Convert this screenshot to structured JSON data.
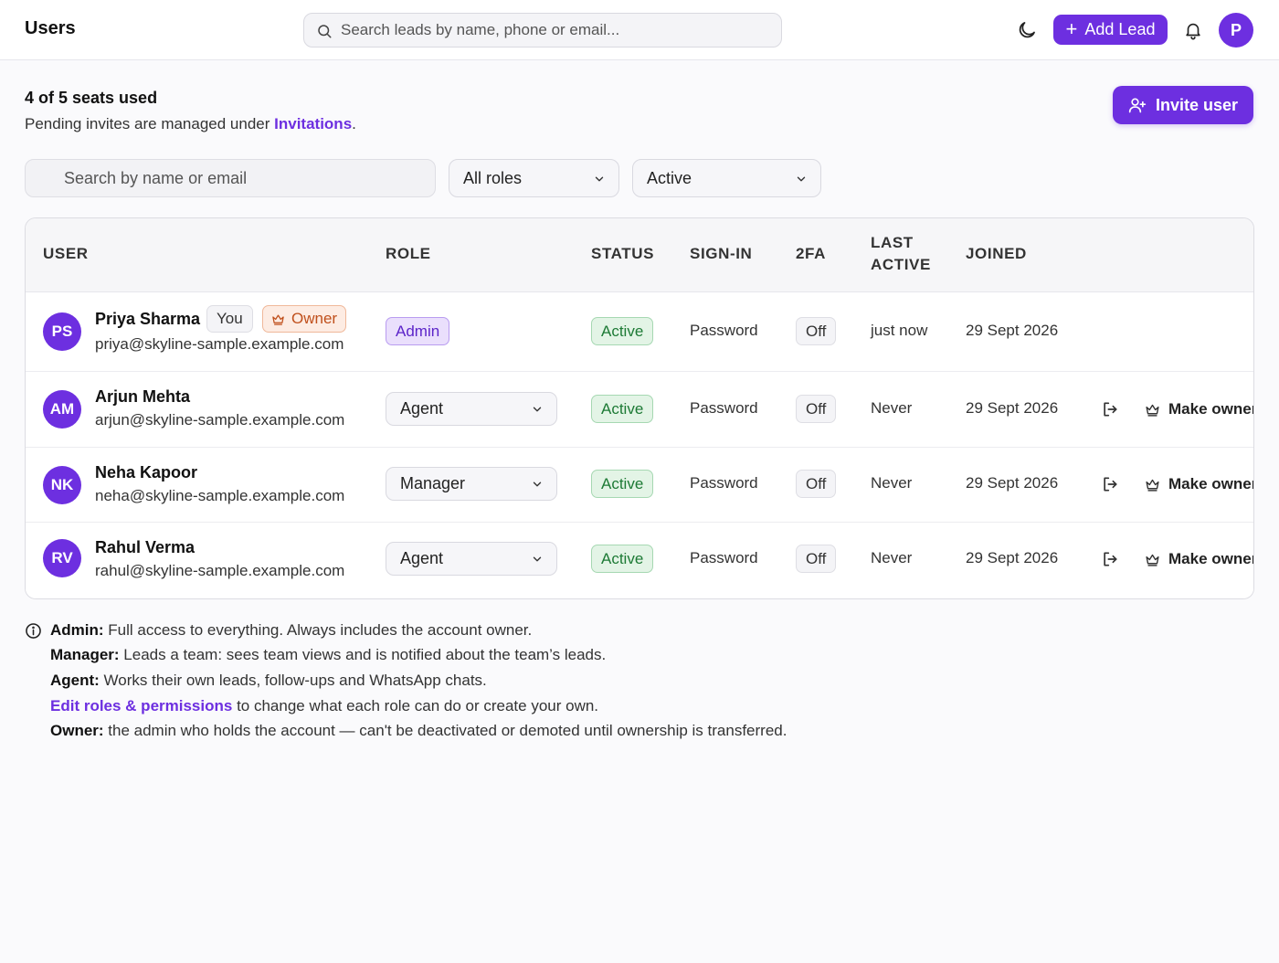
{
  "app": {
    "title": "Users"
  },
  "topbar": {
    "search_placeholder": "Search leads by name, phone or email...",
    "add_lead_label": "Add Lead",
    "add_lead_icon": "plus-icon",
    "profile_initial": "P",
    "theme_icon": "moon-icon",
    "notifications_icon": "bell-icon"
  },
  "seats": {
    "title": "4 of 5 seats used",
    "subtitle_prefix": "Pending invites are managed under ",
    "invitations_link": "Invitations",
    "subtitle_suffix": "."
  },
  "invite_button": {
    "label": "Invite user",
    "icon": "user-plus-icon"
  },
  "filters": {
    "search_placeholder": "Search by name or email",
    "role_value": "All roles",
    "status_value": "Active"
  },
  "table": {
    "headers": {
      "user": "USER",
      "role": "ROLE",
      "status": "STATUS",
      "signin": "SIGN-IN",
      "twofa": "2FA",
      "last_active_1": "LAST",
      "last_active_2": "ACTIVE",
      "joined": "JOINED"
    },
    "rows": [
      {
        "initials": "PS",
        "name": "Priya Sharma",
        "email": "priya@skyline-sample.example.com",
        "you_badge": "You",
        "owner_badge": "Owner",
        "role": "Admin",
        "status": "Active",
        "signin": "Password",
        "twofa": "Off",
        "last_active": "just now",
        "joined": "29 Sept 2026"
      },
      {
        "initials": "AM",
        "name": "Arjun Mehta",
        "email": "arjun@skyline-sample.example.com",
        "role": "Agent",
        "status": "Active",
        "signin": "Password",
        "twofa": "Off",
        "last_active": "Never",
        "joined": "29 Sept 2026",
        "make_owner": "Make owner"
      },
      {
        "initials": "NK",
        "name": "Neha Kapoor",
        "email": "neha@skyline-sample.example.com",
        "role": "Manager",
        "status": "Active",
        "signin": "Password",
        "twofa": "Off",
        "last_active": "Never",
        "joined": "29 Sept 2026",
        "make_owner": "Make owner"
      },
      {
        "initials": "RV",
        "name": "Rahul Verma",
        "email": "rahul@skyline-sample.example.com",
        "role": "Agent",
        "status": "Active",
        "signin": "Password",
        "twofa": "Off",
        "last_active": "Never",
        "joined": "29 Sept 2026",
        "make_owner": "Make owner"
      }
    ]
  },
  "notes": {
    "admin_label": "Admin:",
    "admin_text": " Full access to everything. Always includes the account owner.",
    "manager_label": "Manager:",
    "manager_text": " Leads a team: sees team views and is notified about the team’s leads.",
    "agent_label": "Agent:",
    "agent_text": " Works their own leads, follow-ups and WhatsApp chats.",
    "edit_link": "Edit roles & permissions",
    "edit_text": " to change what each role can do or create your own.",
    "owner_label": "Owner:",
    "owner_text": " the admin who holds the account — can't be deactivated or demoted until ownership is transferred."
  },
  "colors": {
    "brand": "#6d2fe0",
    "active_green": "#1d7a35",
    "owner_orange": "#c0501c"
  }
}
